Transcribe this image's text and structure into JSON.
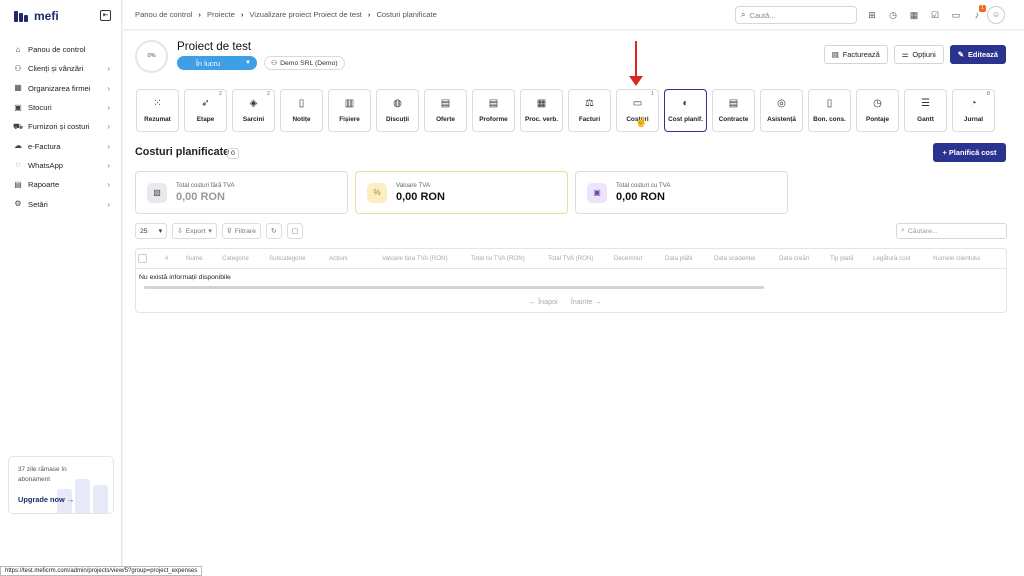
{
  "sidebar": {
    "logo_text": "mefi",
    "items": [
      {
        "label": "Panou de control",
        "icon": "home-icon",
        "chevron": false
      },
      {
        "label": "Clienți și vânzări",
        "icon": "users-icon",
        "chevron": true
      },
      {
        "label": "Organizarea firmei",
        "icon": "building-icon",
        "chevron": true
      },
      {
        "label": "Stocuri",
        "icon": "box-icon",
        "chevron": true
      },
      {
        "label": "Furnizori și costuri",
        "icon": "truck-icon",
        "chevron": true
      },
      {
        "label": "e-Factura",
        "icon": "cloud-icon",
        "chevron": true
      },
      {
        "label": "WhatsApp",
        "icon": "chat-icon",
        "chevron": true
      },
      {
        "label": "Rapoarte",
        "icon": "clipboard-icon",
        "chevron": true
      },
      {
        "label": "Setări",
        "icon": "gear-icon",
        "chevron": true
      }
    ],
    "trial_text": "37 zile rămase în abonament",
    "upgrade_label": "Upgrade now"
  },
  "status_url": "https://test.meficrm.com/admin/projects/view/5?group=project_expenses",
  "topbar": {
    "breadcrumb": [
      "Panou de control",
      "Proiecte",
      "Vizualizare proiect Proiect de test",
      "Costuri planificate"
    ],
    "search_placeholder": "Caută...",
    "notif_count": "1"
  },
  "project": {
    "progress": "0%",
    "title": "Proiect de test",
    "status": "În lucru",
    "client": "Demo SRL (Demo)",
    "actions": {
      "invoice": "Facturează",
      "options": "Opțiuni",
      "edit": "Editează"
    }
  },
  "tiles": [
    {
      "label": "Rezumat",
      "icon": "grid-icon",
      "count": ""
    },
    {
      "label": "Etape",
      "icon": "rocket-icon",
      "count": "2"
    },
    {
      "label": "Sarcini",
      "icon": "layers-icon",
      "count": "2"
    },
    {
      "label": "Notițe",
      "icon": "note-icon",
      "count": ""
    },
    {
      "label": "Fișiere",
      "icon": "file-icon",
      "count": ""
    },
    {
      "label": "Discuții",
      "icon": "discussion-icon",
      "count": ""
    },
    {
      "label": "Oferte",
      "icon": "offer-icon",
      "count": ""
    },
    {
      "label": "Proforme",
      "icon": "proforma-icon",
      "count": ""
    },
    {
      "label": "Proc. verb.",
      "icon": "report-icon",
      "count": ""
    },
    {
      "label": "Facturi",
      "icon": "invoice-icon",
      "count": ""
    },
    {
      "label": "Costuri",
      "icon": "money-icon",
      "count": "1"
    },
    {
      "label": "Cost planif.",
      "icon": "piggy-bank-icon",
      "count": ""
    },
    {
      "label": "Contracte",
      "icon": "contract-icon",
      "count": ""
    },
    {
      "label": "Asistență",
      "icon": "lifebuoy-icon",
      "count": ""
    },
    {
      "label": "Bon. cons.",
      "icon": "receipt-icon",
      "count": ""
    },
    {
      "label": "Pontaje",
      "icon": "clock-icon",
      "count": ""
    },
    {
      "label": "Gantt",
      "icon": "gantt-icon",
      "count": ""
    },
    {
      "label": "Jurnal",
      "icon": "history-icon",
      "count": "8"
    }
  ],
  "section": {
    "title": "Costuri planificate",
    "count": "0",
    "plan_button": "Planifică cost"
  },
  "cards": [
    {
      "label": "Total costuri fără TVA",
      "value": "0,00 RON"
    },
    {
      "label": "Valoare TVA",
      "value": "0,00 RON"
    },
    {
      "label": "Total costuri cu TVA",
      "value": "0,00 RON"
    }
  ],
  "toolbar": {
    "page_size": "25",
    "export": "Export",
    "filter": "Filtrare",
    "search_placeholder": "Căutare..."
  },
  "table": {
    "columns": [
      "#",
      "Nume",
      "Categorie",
      "Subcategorie",
      "Acțiuni",
      "Valoare fara TVA (RON)",
      "Total cu TVA (RON)",
      "Total TVA (RON)",
      "Decemnut",
      "Data plătii",
      "Data scadenței",
      "Data creări",
      "Tip plată",
      "Legătură cost",
      "Numele clientului"
    ],
    "empty_message": "Nu există informații disponibile"
  },
  "pager": {
    "prev": "← Înapoi",
    "next": "Înainte →"
  }
}
